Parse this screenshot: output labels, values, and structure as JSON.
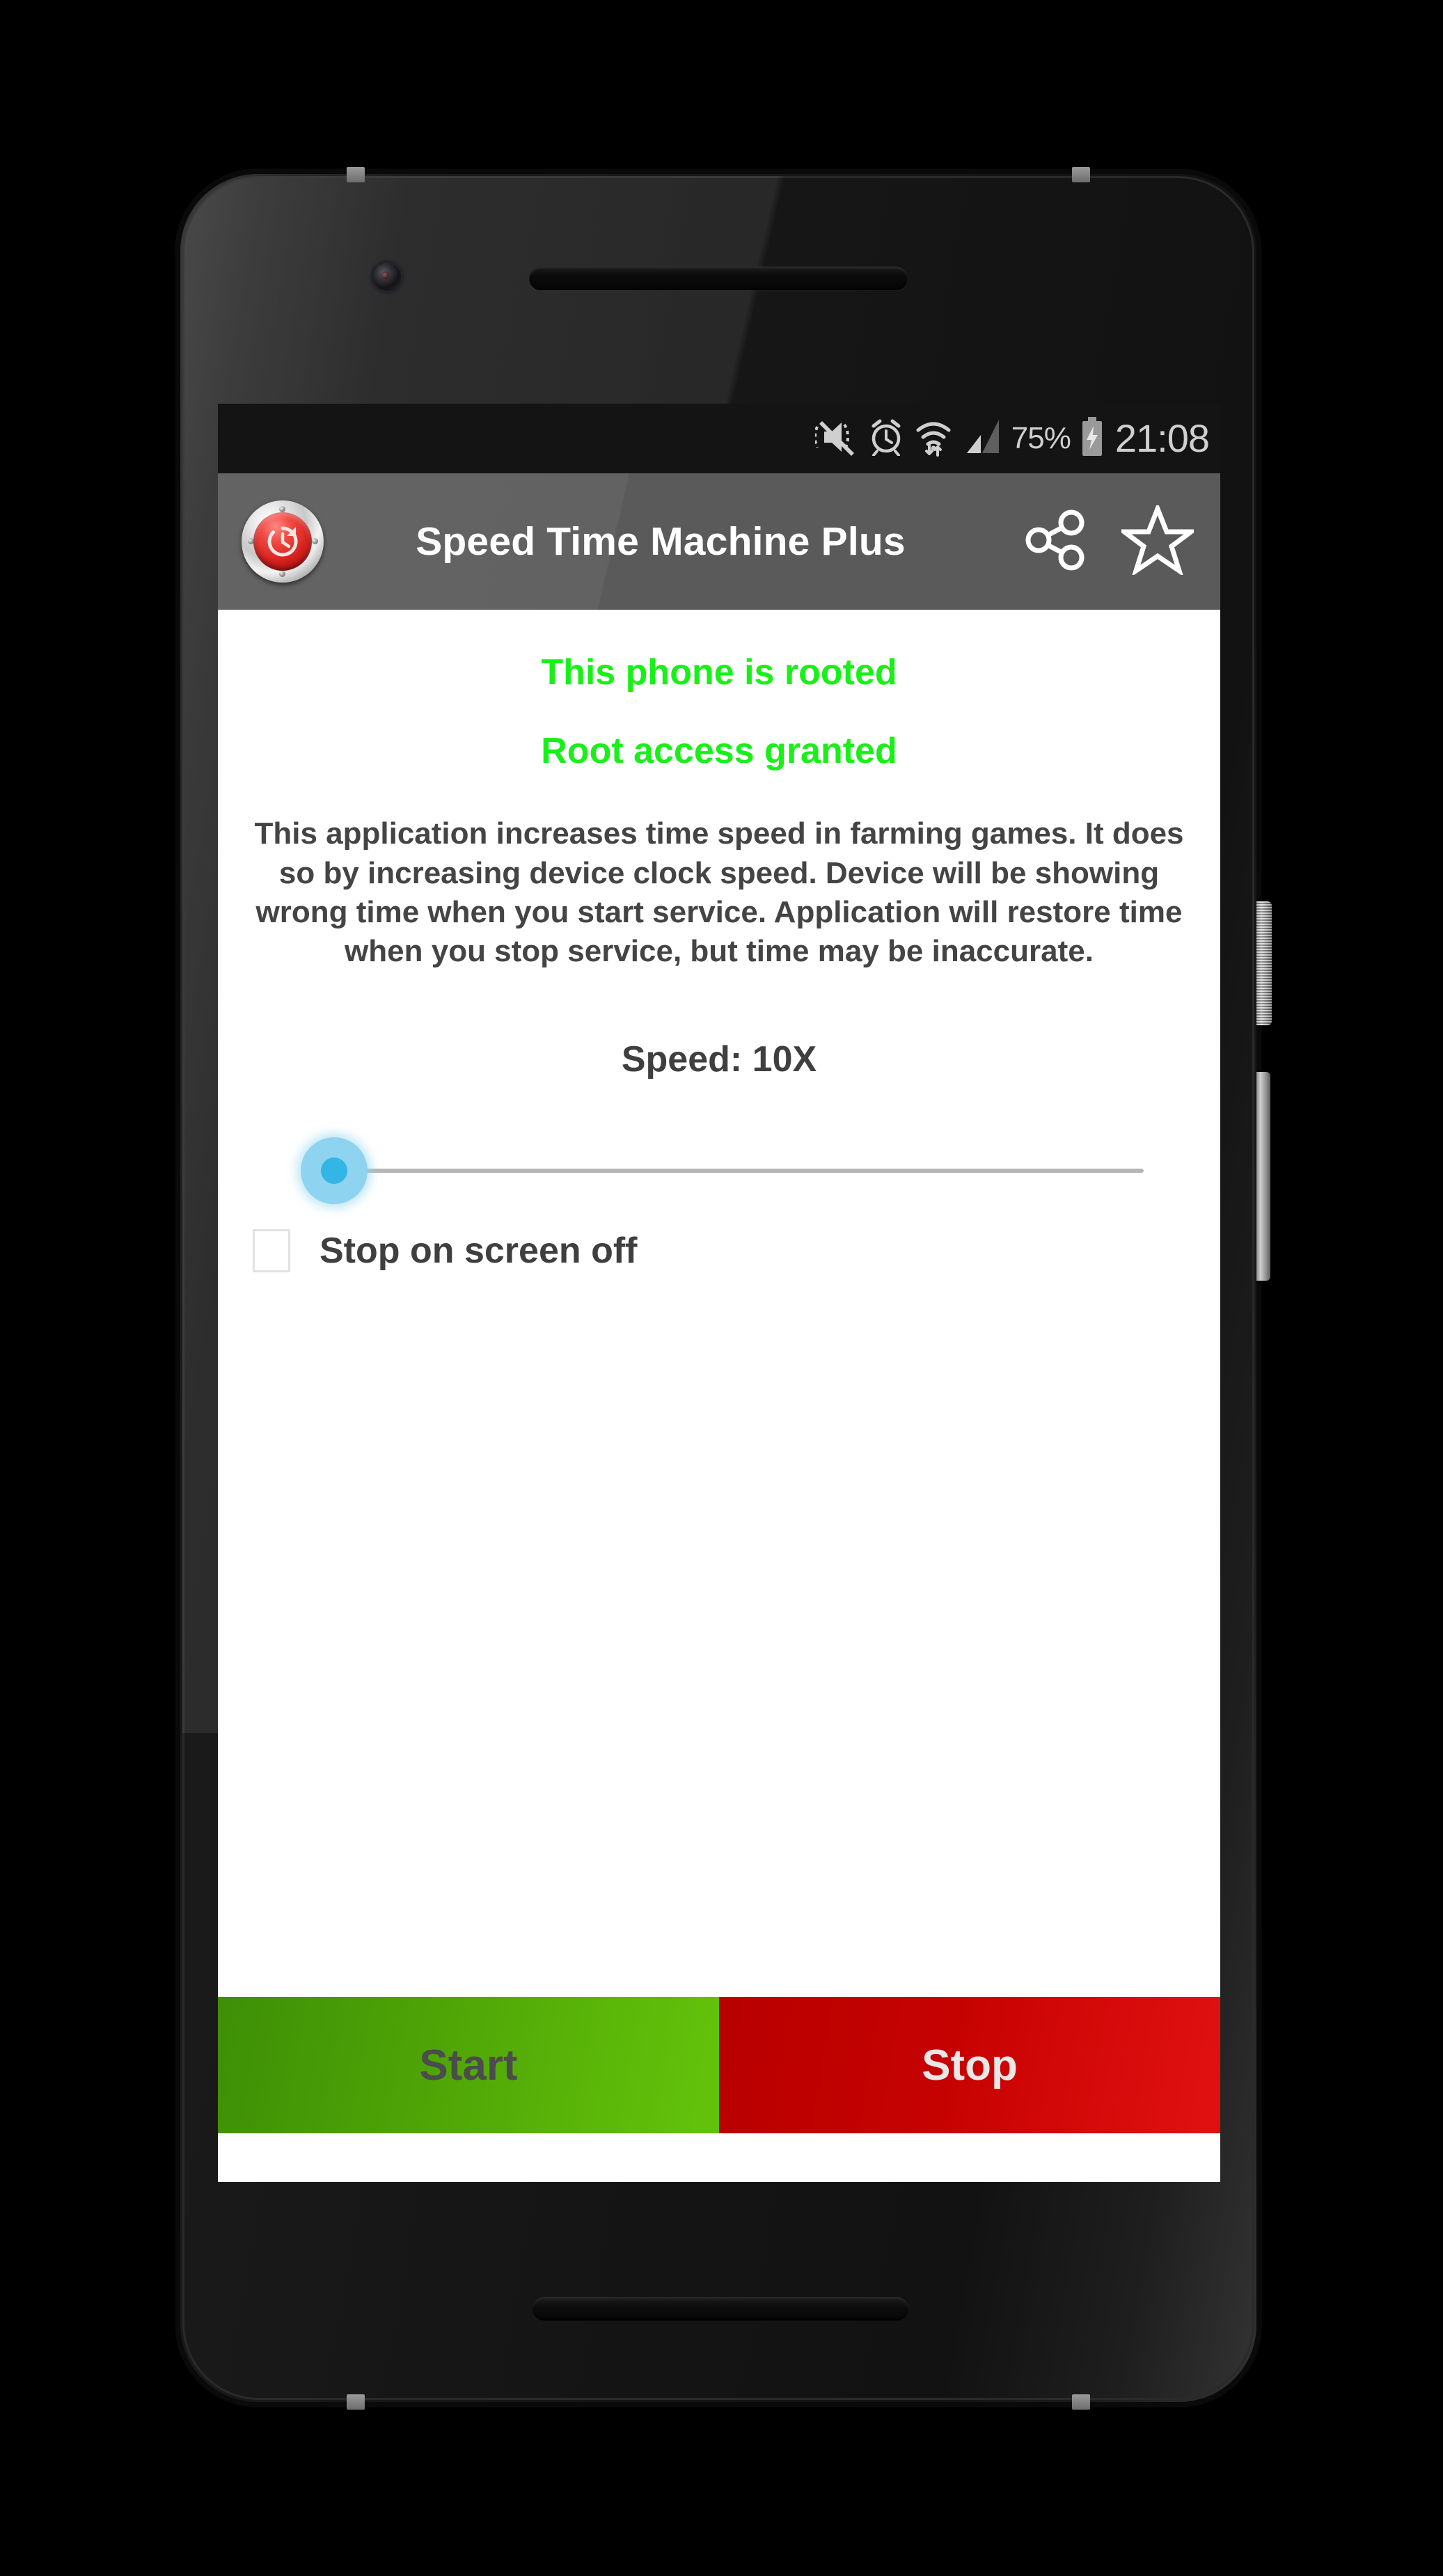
{
  "status_bar": {
    "battery_percent": "75%",
    "clock": "21:08",
    "icons": [
      "mute-vibrate-icon",
      "alarm-icon",
      "wifi-icon",
      "signal-icon",
      "battery-charging-icon"
    ]
  },
  "app_bar": {
    "app_icon": "red-clock-app-icon",
    "title": "Speed Time Machine Plus",
    "share_icon": "share-icon",
    "star_icon": "star-outline-icon"
  },
  "content": {
    "root_status_line_1": "This phone is rooted",
    "root_status_line_2": "Root access granted",
    "root_status_color": "#18f018",
    "description": "This application increases time speed in farming games. It does so by increasing device clock speed. Device will be showing wrong time when you start service. Application will restore time when you stop service, but time may be inaccurate.",
    "speed_label": "Speed: 10X",
    "speed_value": "10X",
    "slider": {
      "position_percent": 0,
      "thumb_color": "#33b5e5",
      "halo_color": "#8ed3ef",
      "track_color": "#b6b6b6"
    },
    "checkbox": {
      "label": "Stop on screen off",
      "checked": false
    }
  },
  "bottom_bar": {
    "start_label": "Start",
    "start_color": "#4fa506",
    "stop_label": "Stop",
    "stop_color": "#c60201"
  }
}
